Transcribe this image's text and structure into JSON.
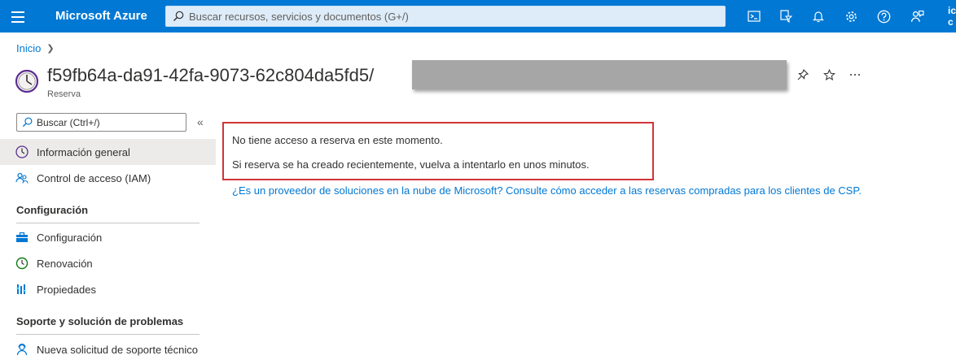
{
  "topbar": {
    "brand": "Microsoft Azure",
    "search_placeholder": "Buscar recursos, servicios y documentos (G+/)",
    "account_line1": "ic",
    "account_line2": "c",
    "icons": [
      "menu-icon",
      "search-icon",
      "cloud-shell-icon",
      "directory-filter-icon",
      "notifications-icon",
      "settings-icon",
      "help-icon",
      "feedback-icon"
    ]
  },
  "breadcrumb": {
    "home": "Inicio"
  },
  "header": {
    "title": "f59fb64a-da91-42fa-9073-62c804da5fd5/",
    "subtitle": "Reserva",
    "icon": "clock-icon",
    "actions": [
      "pin-icon",
      "star-icon",
      "more-icon"
    ]
  },
  "sidebar": {
    "search_placeholder": "Buscar (Ctrl+/)",
    "items_top": [
      {
        "label": "Información general",
        "icon": "clock-icon",
        "active": true
      },
      {
        "label": "Control de acceso (IAM)",
        "icon": "users-icon"
      }
    ],
    "section_config": "Configuración",
    "items_config": [
      {
        "label": "Configuración",
        "icon": "toolbox-icon"
      },
      {
        "label": "Renovación",
        "icon": "renew-clock-icon"
      },
      {
        "label": "Propiedades",
        "icon": "properties-icon"
      }
    ],
    "section_support": "Soporte y solución de problemas",
    "items_support": [
      {
        "label": "Nueva solicitud de soporte técnico",
        "icon": "support-person-icon"
      }
    ]
  },
  "main": {
    "message_line1": "No tiene acceso a reserva en este momento.",
    "message_line2": "Si reserva se ha creado recientemente, vuelva a intentarlo en unos minutos.",
    "csp_link": "¿Es un proveedor de soluciones en la nube de Microsoft? Consulte cómo acceder a las reservas compradas para los clientes de CSP."
  },
  "colors": {
    "azure_blue": "#0078d4",
    "alert_red": "#d13438",
    "redaction_gray": "#a6a6a6"
  }
}
